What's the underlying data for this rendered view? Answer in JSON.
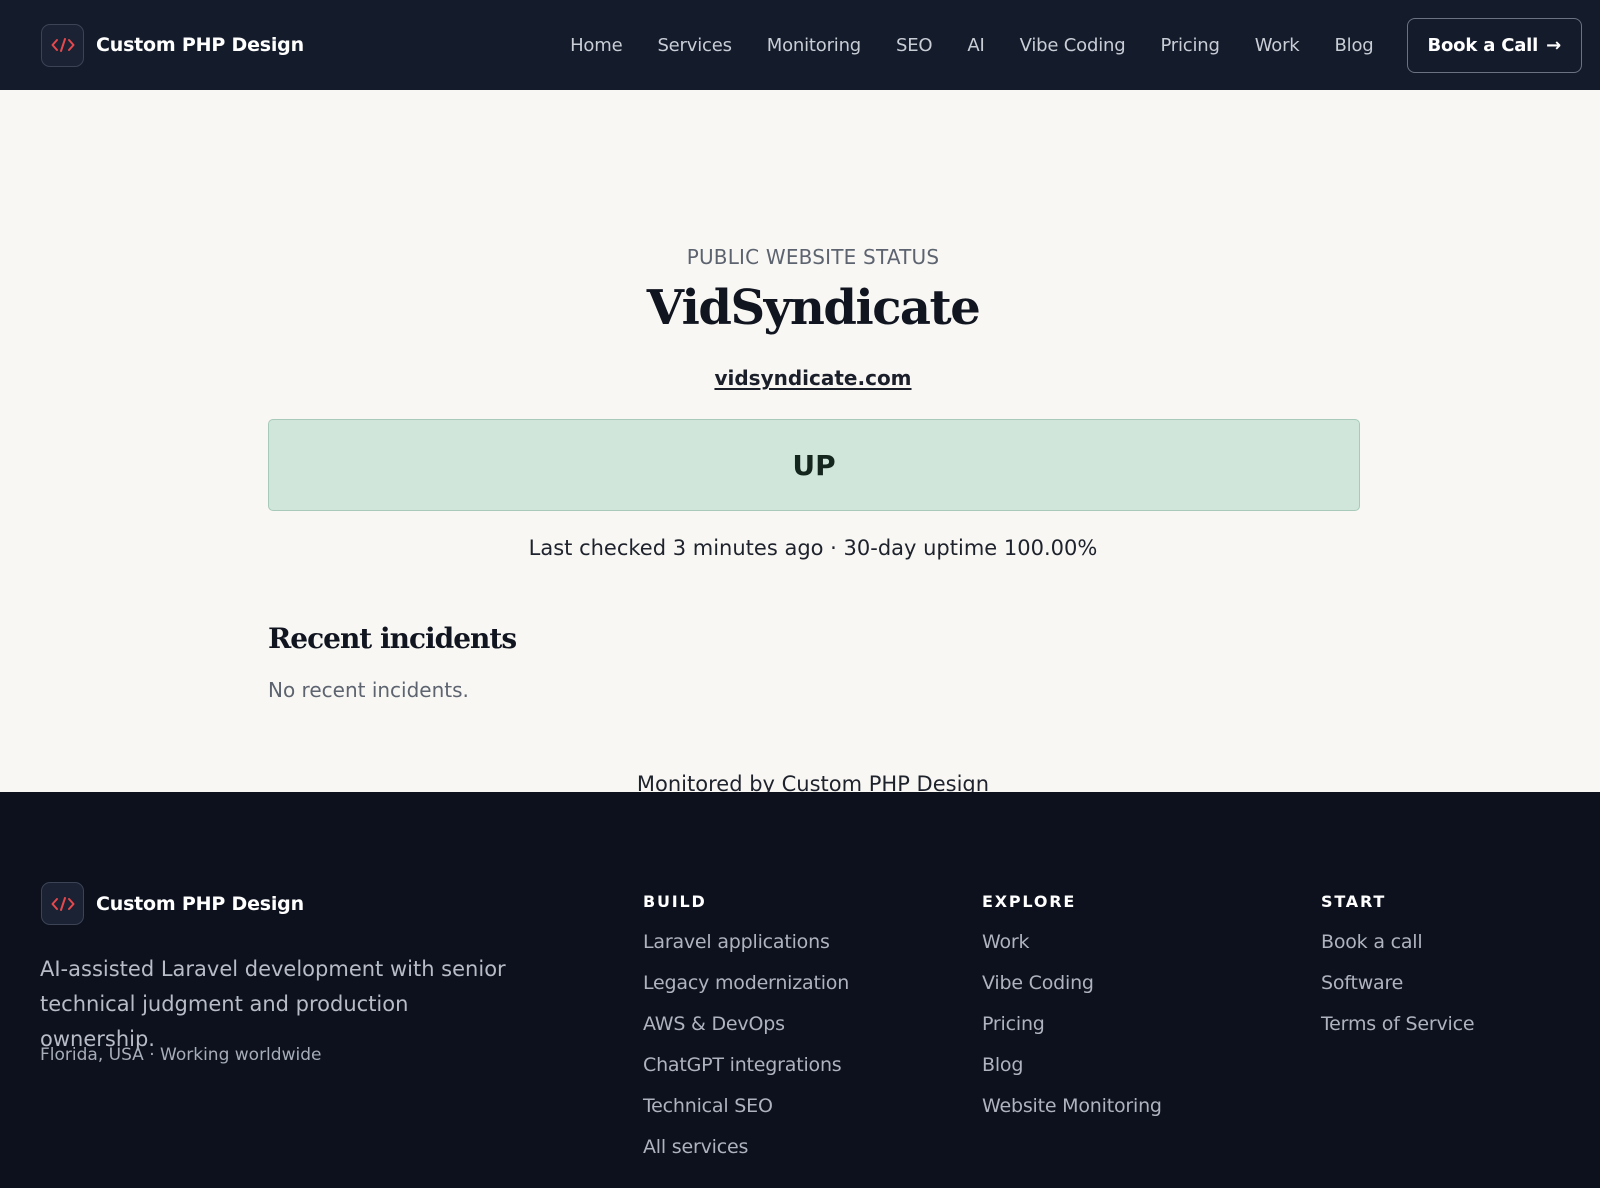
{
  "header": {
    "brand_name": "Custom PHP Design",
    "nav": [
      "Home",
      "Services",
      "Monitoring",
      "SEO",
      "AI",
      "Vibe Coding",
      "Pricing",
      "Work",
      "Blog"
    ],
    "cta_label": "Book a Call",
    "cta_arrow": "→"
  },
  "main": {
    "eyebrow": "PUBLIC WEBSITE STATUS",
    "site_name": "VidSyndicate",
    "domain": "vidsyndicate.com",
    "status": "UP",
    "meta_text": "Last checked 3 minutes ago · 30-day uptime 100.00%",
    "incidents_title": "Recent incidents",
    "incidents_empty": "No recent incidents.",
    "monitored_prefix": "Monitored by ",
    "monitored_link": "Custom PHP Design"
  },
  "footer": {
    "brand_name": "Custom PHP Design",
    "tagline": "AI-assisted Laravel development with senior technical judgment and production ownership.",
    "location": "Florida, USA · Working worldwide",
    "columns": [
      {
        "title": "BUILD",
        "links": [
          "Laravel applications",
          "Legacy modernization",
          "AWS & DevOps",
          "ChatGPT integrations",
          "Technical SEO",
          "All services"
        ]
      },
      {
        "title": "EXPLORE",
        "links": [
          "Work",
          "Vibe Coding",
          "Pricing",
          "Blog",
          "Website Monitoring"
        ]
      },
      {
        "title": "START",
        "links": [
          "Book a call",
          "Software",
          "Terms of Service"
        ]
      }
    ]
  },
  "colors": {
    "header_bg": "#141b2b",
    "footer_bg": "#0c111d",
    "page_bg": "#f8f7f4",
    "status_up_bg": "#d0e6db",
    "logo_accent": "#e5484d"
  },
  "icons": {
    "logo": "code-brackets-icon"
  }
}
